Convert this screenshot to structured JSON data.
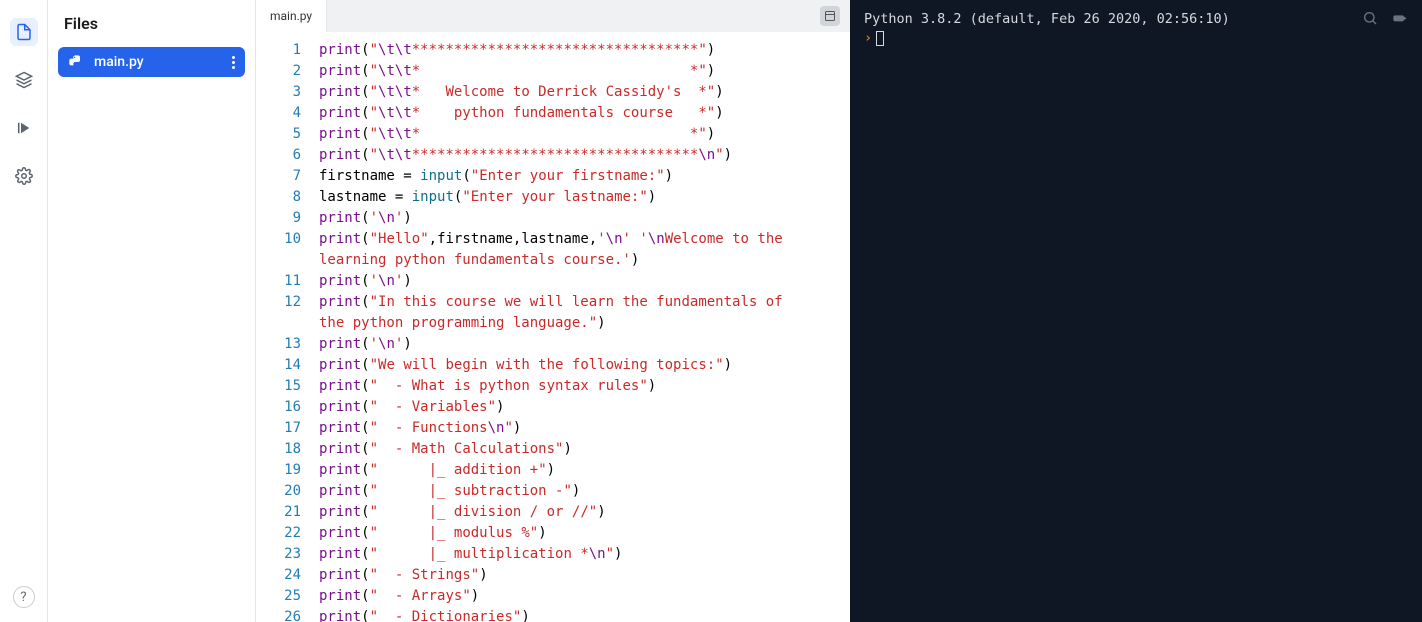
{
  "iconbar": {
    "items": [
      "files",
      "packages",
      "run",
      "settings"
    ]
  },
  "sidebar": {
    "title": "Files",
    "file": {
      "name": "main.py"
    }
  },
  "tab": {
    "label": "main.py"
  },
  "code": {
    "lines": [
      {
        "n": 1,
        "t": "print",
        "s": "\"\\t\\t**********************************\"",
        "post": ""
      },
      {
        "n": 2,
        "t": "print",
        "s": "\"\\t\\t*                                *\"",
        "post": ""
      },
      {
        "n": 3,
        "t": "print",
        "s": "\"\\t\\t*   Welcome to Derrick Cassidy's  *\"",
        "post": ""
      },
      {
        "n": 4,
        "t": "print",
        "s": "\"\\t\\t*    python fundamentals course   *\"",
        "post": ""
      },
      {
        "n": 5,
        "t": "print",
        "s": "\"\\t\\t*                                *\"",
        "post": ""
      },
      {
        "n": 6,
        "t": "print",
        "s": "\"\\t\\t**********************************\\n\"",
        "post": ""
      },
      {
        "n": 7,
        "assign": "firstname",
        "t": "input",
        "s": "\"Enter your firstname:\""
      },
      {
        "n": 8,
        "assign": "lastname",
        "t": "input",
        "s": "\"Enter your lastname:\""
      },
      {
        "n": 9,
        "t": "print",
        "sq": "'\\n'"
      },
      {
        "n": 10,
        "raw10": true
      },
      {
        "n": 0,
        "cont10": true
      },
      {
        "n": 11,
        "t": "print",
        "sq": "'\\n'"
      },
      {
        "n": 12,
        "raw12": true
      },
      {
        "n": 0,
        "cont12": true
      },
      {
        "n": 13,
        "t": "print",
        "sq": "'\\n'"
      },
      {
        "n": 14,
        "t": "print",
        "s": "\"We will begin with the following topics:\""
      },
      {
        "n": 15,
        "t": "print",
        "s": "\"  - What is python syntax rules\""
      },
      {
        "n": 16,
        "t": "print",
        "s": "\"  - Variables\""
      },
      {
        "n": 17,
        "t": "print",
        "s": "\"  - Functions\\n\""
      },
      {
        "n": 18,
        "t": "print",
        "s": "\"  - Math Calculations\""
      },
      {
        "n": 19,
        "t": "print",
        "s": "\"      |_ addition +\""
      },
      {
        "n": 20,
        "t": "print",
        "s": "\"      |_ subtraction -\""
      },
      {
        "n": 21,
        "t": "print",
        "s": "\"      |_ division / or //\""
      },
      {
        "n": 22,
        "t": "print",
        "s": "\"      |_ modulus %\""
      },
      {
        "n": 23,
        "t": "print",
        "s": "\"      |_ multiplication *\\n\""
      },
      {
        "n": 24,
        "t": "print",
        "s": "\"  - Strings\""
      },
      {
        "n": 25,
        "t": "print",
        "s": "\"  - Arrays\""
      },
      {
        "n": 26,
        "t": "print",
        "s": "\"  - Dictionaries\""
      }
    ],
    "line10a": "\"Hello\"",
    "line10b": "'\\n'",
    "line10c": "'\\nWelcome to the ",
    "line10d": "learning python fundamentals course.'",
    "line12a": "\"In this course we will learn the fundamentals of ",
    "line12b": "the python programming language.\""
  },
  "console": {
    "header": "Python 3.8.2 (default, Feb 26 2020, 02:56:10)",
    "prompt": ">"
  }
}
